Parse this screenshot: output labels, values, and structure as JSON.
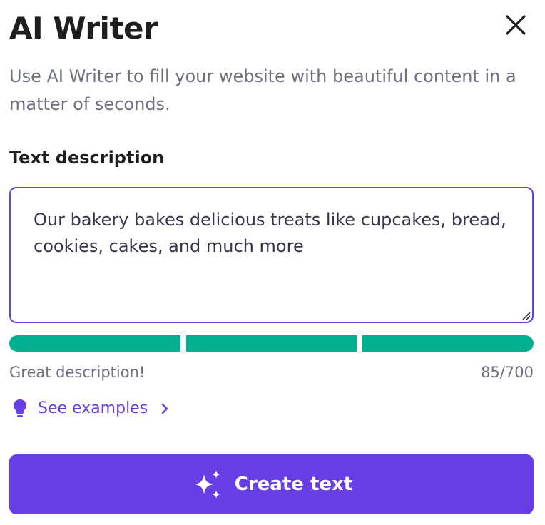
{
  "header": {
    "title": "AI Writer",
    "close_icon": "close-icon"
  },
  "subtitle": "Use AI Writer to fill your website with beautiful content in a matter of seconds.",
  "description": {
    "label": "Text description",
    "value": "Our bakery bakes delicious treats like cupcakes, bread, cookies, cakes, and much more",
    "quality_level": 1.0,
    "quality_color": "#00b090",
    "status": "Great description!",
    "counter": "85/700"
  },
  "examples": {
    "label": "See examples",
    "icon": "lightbulb-icon",
    "chevron_icon": "chevron-right-icon"
  },
  "create_button": {
    "label": "Create text",
    "icon": "sparkles-icon"
  },
  "colors": {
    "accent": "#673de6",
    "success": "#00b090",
    "text_primary": "#1d1e20",
    "text_muted": "#6d7081"
  }
}
